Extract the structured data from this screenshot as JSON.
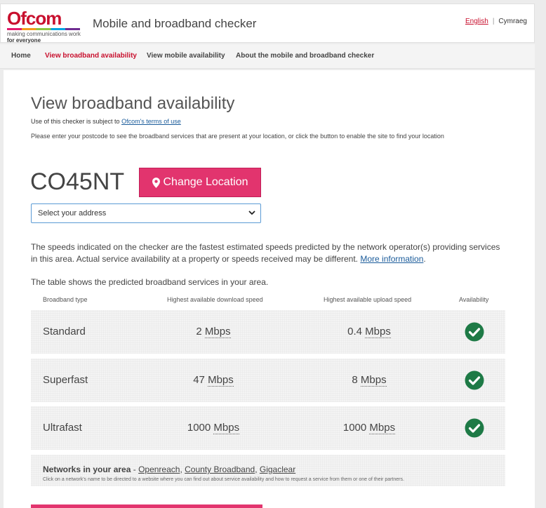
{
  "header": {
    "logo_word": "Ofcom",
    "logo_tagline1": "making communications work",
    "logo_tagline2": "for everyone",
    "site_title": "Mobile and broadband checker",
    "lang_english": "English",
    "lang_separator": "|",
    "lang_welsh": "Cymraeg"
  },
  "nav": {
    "items": [
      {
        "label": "Home"
      },
      {
        "label": "View broadband availability"
      },
      {
        "label": "View mobile availability"
      },
      {
        "label": "About the mobile and broadband checker"
      }
    ],
    "active_index": 1
  },
  "main": {
    "title": "View broadband availability",
    "terms_prefix": "Use of this checker is subject to ",
    "terms_link": "Ofcom's terms of use",
    "intro": "Please enter your postcode to see the broadband services that are present at your location, or click the button to enable the site to find your location",
    "postcode": "CO45NT",
    "change_location_label": "Change Location",
    "address_select": "Select your address",
    "speeds_note": "The speeds indicated on the checker are the fastest estimated speeds predicted by the network operator(s) providing services in this area. Actual service availability at a property or speeds received may be different. ",
    "more_info_link": "More information",
    "speeds_note_end": ".",
    "table_note": "The table shows the predicted broadband services in your area."
  },
  "table": {
    "headers": [
      "Broadband type",
      "Highest available download speed",
      "Highest available upload speed",
      "Availability"
    ],
    "rows": [
      {
        "type": "Standard",
        "down": "2",
        "down_unit": "Mbps",
        "up": "0.4",
        "up_unit": "Mbps",
        "available": true
      },
      {
        "type": "Superfast",
        "down": "47",
        "down_unit": "Mbps",
        "up": "8",
        "up_unit": "Mbps",
        "available": true
      },
      {
        "type": "Ultrafast",
        "down": "1000",
        "down_unit": "Mbps",
        "up": "1000",
        "up_unit": "Mbps",
        "available": true
      }
    ]
  },
  "networks": {
    "label": "Networks in your area",
    "dash": " - ",
    "list": [
      "Openreach",
      "County Broadband",
      "Gigaclear"
    ],
    "sep": ", ",
    "hint": "Click on a network's name to be directed to a website where you can find out about service availability and how to request a service from them or one of their partners."
  },
  "colors": {
    "brand": "#c8102e",
    "button": "#e2346e",
    "check": "#1e7a46",
    "link": "#1a5b9a"
  }
}
